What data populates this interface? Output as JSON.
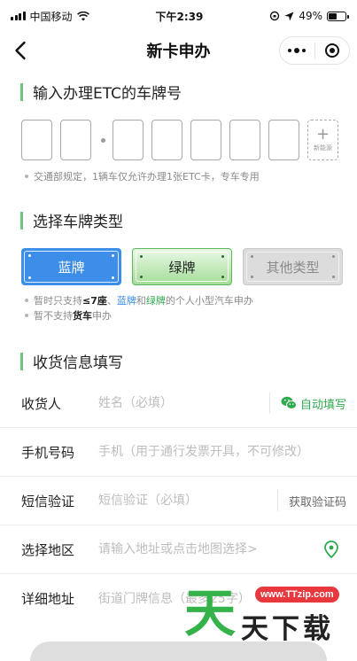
{
  "status_bar": {
    "carrier": "中国移动",
    "time": "下午2:39",
    "battery": "49%"
  },
  "nav": {
    "title": "新卡申办"
  },
  "plate_section": {
    "title": "输入办理ETC的车牌号",
    "new_energy_plus": "+",
    "new_energy_label": "新能源",
    "note": "交通部规定，1辆车仅允许办理1张ETC卡，专车专用"
  },
  "plate_type_section": {
    "title": "选择车牌类型",
    "types": [
      {
        "label": "蓝牌"
      },
      {
        "label": "绿牌"
      },
      {
        "label": "其他类型"
      }
    ],
    "notes": [
      {
        "parts": [
          "暂时只支持",
          "≤7座",
          "、",
          "蓝牌",
          "和",
          "绿牌",
          "的个人小型汽车申办"
        ]
      },
      {
        "parts": [
          "暂不支持",
          "货车",
          "申办"
        ]
      }
    ]
  },
  "delivery_section": {
    "title": "收货信息填写",
    "rows": [
      {
        "label": "收货人",
        "placeholder": "姓名（必填）",
        "action": "自动填写"
      },
      {
        "label": "手机号码",
        "placeholder": "手机（用于通行发票开具，不可修改）"
      },
      {
        "label": "短信验证",
        "placeholder": "短信验证（必填）",
        "action": "获取验证码"
      },
      {
        "label": "选择地区",
        "placeholder": "请输入地址或点击地图选择>"
      },
      {
        "label": "详细地址",
        "placeholder": "街道门牌信息（最多25字）"
      }
    ]
  },
  "watermark": {
    "url": "www.TTzip.com",
    "big": "天",
    "small": "天下载"
  },
  "colors": {
    "accent_green": "#2faa4e",
    "section_bar": "#6fc47f",
    "plate_blue": "#3d8ee8",
    "highlight_blue": "#3a8ce6"
  }
}
